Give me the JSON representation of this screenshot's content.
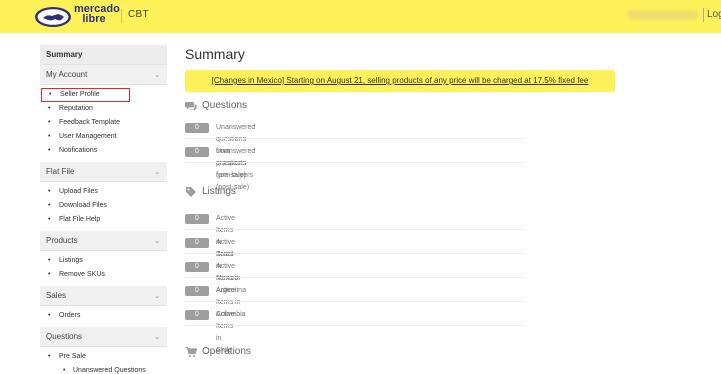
{
  "header": {
    "logo_line1": "mercado",
    "logo_line2": "libre",
    "site": "CBT",
    "login": "Log"
  },
  "sidebar": {
    "summary": "Summary",
    "sections": [
      {
        "title": "My Account",
        "items": [
          "Seller Profile",
          "Reputation",
          "Feedback Template",
          "User Management",
          "Notifications"
        ]
      },
      {
        "title": "Flat File",
        "items": [
          "Upload Files",
          "Download Files",
          "Flat File Help"
        ]
      },
      {
        "title": "Products",
        "items": [
          "Listings",
          "Remove SKUs"
        ]
      },
      {
        "title": "Sales",
        "items": [
          "Orders"
        ]
      },
      {
        "title": "Questions",
        "items": [
          "Pre Sale"
        ],
        "subitems": [
          "Unanswered Questions"
        ]
      }
    ]
  },
  "main": {
    "title": "Summary",
    "notice": "[Changes in Mexico] Starting on August 21, selling products of any price will be charged at 17.5% fixed fee",
    "questions": {
      "heading": "Questions",
      "rows": [
        {
          "count": "0",
          "label": "Unanswered questions from prospects (pre-sale)"
        },
        {
          "count": "0",
          "label": "Unanswered questions from buyers (post-sale)"
        }
      ]
    },
    "listings": {
      "heading": "Listings",
      "rows": [
        {
          "count": "0",
          "label": "Active Items in Brazil"
        },
        {
          "count": "0",
          "label": "Active Items in Mexico"
        },
        {
          "count": "0",
          "label": "Active Items in Argentina"
        },
        {
          "count": "0",
          "label": "Active Items in Colombia"
        },
        {
          "count": "0",
          "label": "Active Items in Chile"
        }
      ]
    },
    "operations": {
      "heading": "Operations"
    }
  },
  "colors": {
    "brand_yellow": "#fff159",
    "brand_blue": "#2d3277",
    "badge_gray": "#9e9e9e",
    "highlight_red": "#e3262d"
  },
  "icons": {
    "questions": "chat-bubbles-icon",
    "listings": "tag-icon",
    "operations": "cart-icon",
    "section_toggle": "chevron-down-icon"
  }
}
